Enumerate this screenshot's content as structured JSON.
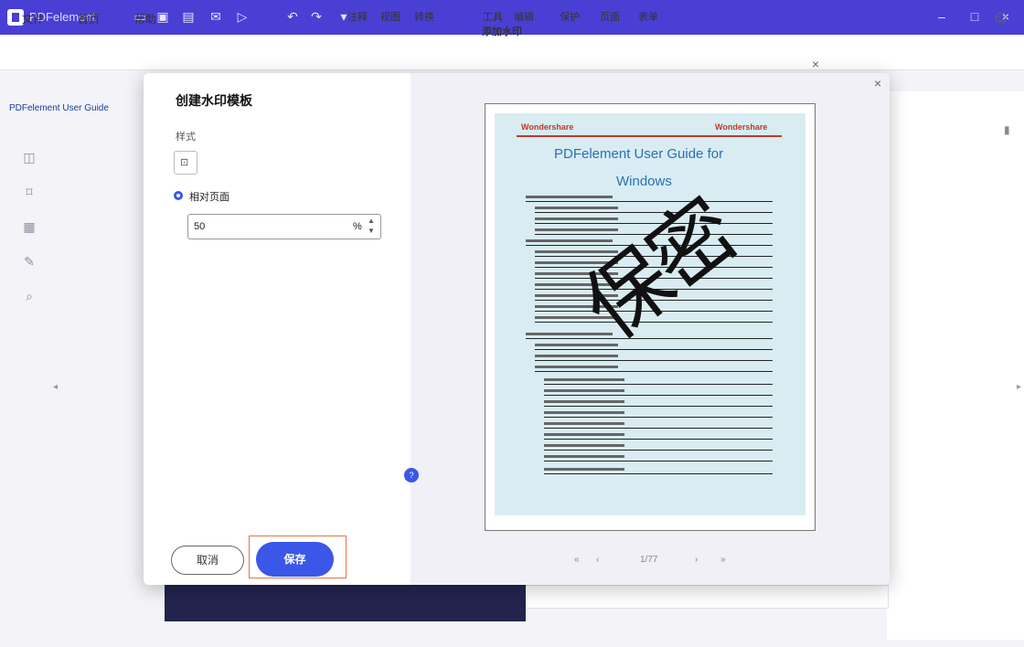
{
  "titlebar": {
    "app_title": "PDFelement",
    "toolbar_icons": [
      "folder-icon",
      "save-icon",
      "print-icon",
      "mail-icon",
      "play-icon",
      "undo-icon",
      "redo-icon",
      "dropdown-icon"
    ],
    "window_controls": [
      "minimize-icon",
      "maximize-icon",
      "close-icon"
    ]
  },
  "menu": {
    "items": [
      "文件",
      "首页",
      "帮助"
    ],
    "tool_tabs": [
      "注释",
      "视图",
      "转换",
      "工具",
      "编辑",
      "保护",
      "页面",
      "表单"
    ],
    "tools_sub": "添加水印"
  },
  "breadcrumb": "PDFelement User Guide",
  "dialog": {
    "title": "创建水印模板",
    "style_label": "样式",
    "radio_label": "相对页面",
    "select_value": "50",
    "select_unit": "%",
    "cancel_label": "取消",
    "ok_label": "保存"
  },
  "preview": {
    "logo_left": "Wondershare",
    "logo_right": "Wondershare",
    "doc_title_line1": "PDFelement User Guide for",
    "doc_title_line2": "Windows",
    "watermark_text": "保密",
    "pager": {
      "first": "«",
      "prev": "‹",
      "page": "1/77",
      "next": "›",
      "last": "»"
    }
  }
}
